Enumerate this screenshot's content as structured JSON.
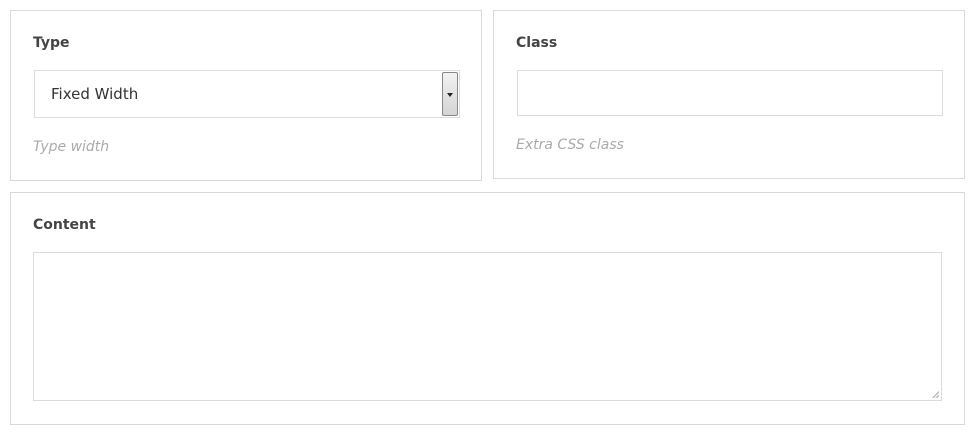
{
  "type_field": {
    "label": "Type",
    "selected_value": "Fixed Width",
    "hint": "Type width"
  },
  "class_field": {
    "label": "Class",
    "value": "",
    "hint": "Extra CSS class"
  },
  "content_field": {
    "label": "Content",
    "value": ""
  },
  "icons": {
    "select_arrow": "chevron-down-icon",
    "textarea_resize": "resize-handle-icon"
  }
}
